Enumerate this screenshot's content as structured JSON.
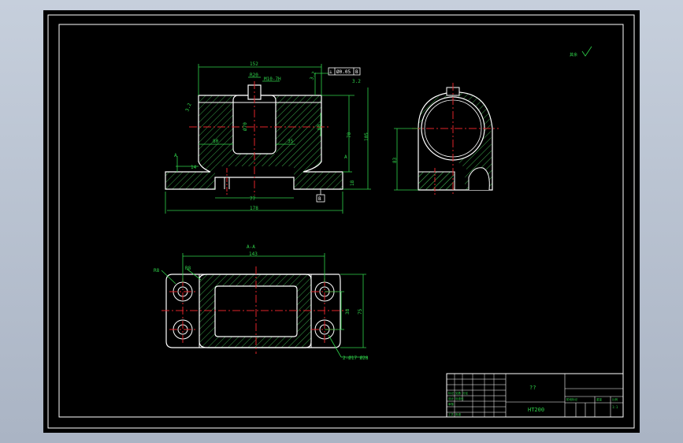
{
  "drawing": {
    "front_view": {
      "dim_top_width": "152",
      "dim_slot": "R20",
      "dim_thread": "M10-7H",
      "dim_bore": "Ø70",
      "dim_height_inner": "70",
      "dim_height_total": "105",
      "dim_left_inner": "80",
      "dim_right_inner": "35",
      "dim_side_tol": "60",
      "dim_base_left": "14",
      "dim_base_inner_width": "77",
      "dim_base_width": "178",
      "dim_base_height": "18",
      "tol_frame_symbol": "⊥",
      "tol_frame_value": "Ø0.05",
      "tol_frame_datum": "B",
      "datum_b": "B",
      "section_mark_left": "A",
      "section_mark_right": "A",
      "roughness_left": "3.2",
      "roughness_right": "3.2",
      "roughness_top": "3.2"
    },
    "side_view": {
      "dim_height": "83"
    },
    "section_view": {
      "section_label": "A-A",
      "dim_length": "143",
      "dim_height_inner": "38",
      "dim_height": "75",
      "label_r_left": "R8",
      "label_r_inner": "R8",
      "hole_callout": "2-Ø17 Ø28"
    },
    "corner_mark": "其余"
  },
  "title_block": {
    "part_name": "??",
    "material": "HT200",
    "scale": "1:1",
    "rows_left": [
      "标记 处数 分区",
      "设计 标准化",
      "审核",
      "工艺 批准"
    ],
    "cells_right": [
      "阶段标记",
      "重量",
      "比例"
    ]
  }
}
